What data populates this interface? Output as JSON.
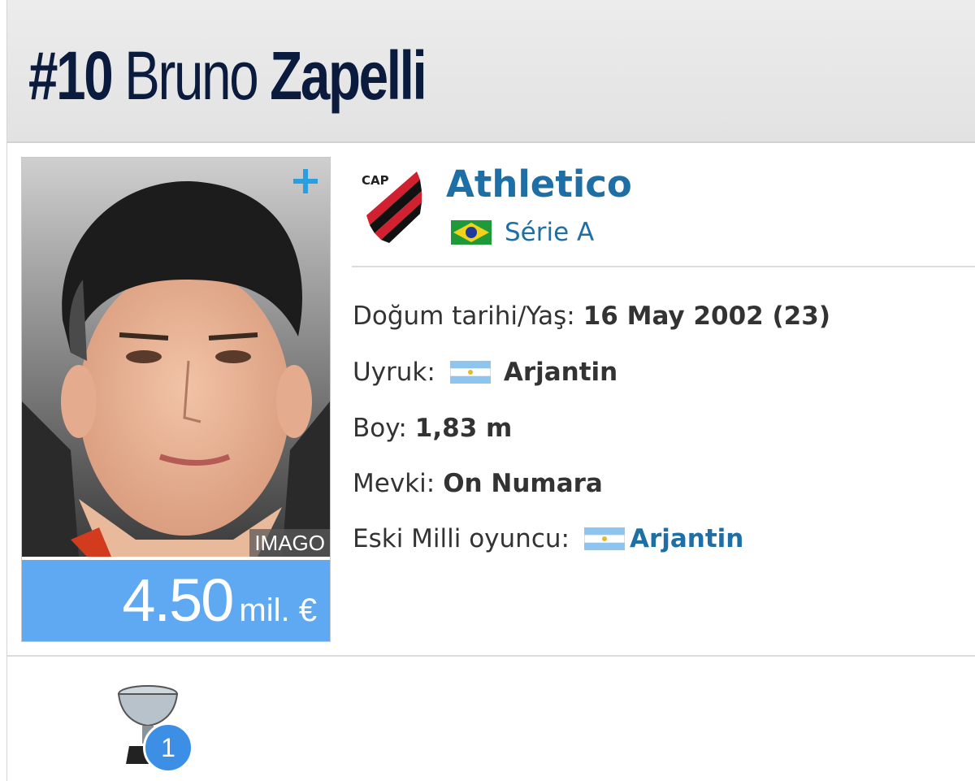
{
  "header": {
    "number": "#10",
    "first_name": "Bruno",
    "last_name": "Zapelli"
  },
  "photo": {
    "credit": "IMAGO",
    "plus_icon": "plus-icon"
  },
  "market_value": {
    "amount": "4.50",
    "unit": "mil. €"
  },
  "club": {
    "name": "Athletico",
    "league": "Série A",
    "league_flag": "brazil-flag-icon",
    "logo": "athletico-paranaense-crest-icon"
  },
  "details": [
    {
      "label": "Doğum tarihi/Yaş:",
      "value": "16 May 2002 (23)"
    },
    {
      "label": "Uyruk:",
      "value": "Arjantin",
      "flag": "argentina-flag-icon"
    },
    {
      "label": "Boy:",
      "value": "1,83 m"
    },
    {
      "label": "Mevki:",
      "value": "On Numara"
    },
    {
      "label": "Eski Milli oyuncu:",
      "value": "Arjantin",
      "flag": "argentina-flag-icon"
    }
  ],
  "trophies": {
    "count": "1",
    "icon": "trophy-icon"
  },
  "colors": {
    "title": "#0a1b3d",
    "link": "#1d6fa5",
    "value_bg": "#5fa8f2",
    "badge": "#3d8fe6"
  }
}
